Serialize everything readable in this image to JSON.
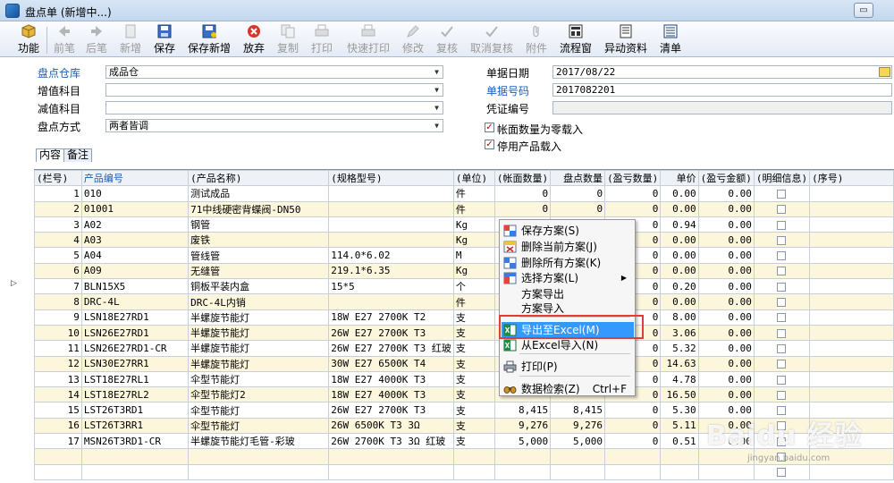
{
  "window": {
    "title": "盘点单 (新增中...)",
    "minimize_symbol": "▭"
  },
  "toolbar": [
    {
      "label": "功能",
      "icon": "function-cube-icon",
      "enabled": true
    },
    {
      "label": "前笔",
      "icon": "arrow-left-icon",
      "enabled": false
    },
    {
      "label": "后笔",
      "icon": "arrow-right-icon",
      "enabled": false
    },
    {
      "label": "新增",
      "icon": "new-document-icon",
      "enabled": false
    },
    {
      "label": "保存",
      "icon": "save-disk-icon",
      "enabled": true
    },
    {
      "label": "保存新增",
      "icon": "save-new-icon",
      "enabled": true
    },
    {
      "label": "放弃",
      "icon": "abandon-x-icon",
      "enabled": true
    },
    {
      "label": "复制",
      "icon": "copy-icon",
      "enabled": false
    },
    {
      "label": "打印",
      "icon": "print-icon",
      "enabled": false
    },
    {
      "label": "快速打印",
      "icon": "quick-print-icon",
      "enabled": false
    },
    {
      "label": "修改",
      "icon": "edit-icon",
      "enabled": false
    },
    {
      "label": "复核",
      "icon": "review-icon",
      "enabled": false
    },
    {
      "label": "取消复核",
      "icon": "cancel-review-icon",
      "enabled": false
    },
    {
      "label": "附件",
      "icon": "paperclip-icon",
      "enabled": false
    },
    {
      "label": "流程窗",
      "icon": "flow-window-icon",
      "enabled": true
    },
    {
      "label": "异动资料",
      "icon": "change-data-icon",
      "enabled": true
    },
    {
      "label": "清单",
      "icon": "list-icon",
      "enabled": true
    }
  ],
  "form": {
    "warehouse_label": "盘点仓库",
    "warehouse_value": "成品仓",
    "add_account_label": "增值科目",
    "add_account_value": "",
    "sub_account_label": "减值科目",
    "sub_account_value": "",
    "method_label": "盘点方式",
    "method_value": "两者皆调",
    "date_label": "单据日期",
    "date_value": "2017/08/22",
    "number_label": "单据号码",
    "number_value": "2017082201",
    "voucher_label": "凭证编号",
    "voucher_value": "",
    "chk_zero_label": "帐面数量为零载入",
    "chk_zero_checked": true,
    "chk_disabled_label": "停用产品载入",
    "chk_disabled_checked": true,
    "check_mark": "✓"
  },
  "tabs": [
    {
      "label": "内容"
    },
    {
      "label": "备注"
    }
  ],
  "grid": {
    "columns": [
      "(栏号)",
      "产品编号",
      "(产品名称)",
      "(规格型号)",
      "(单位)",
      "(帐面数量)",
      "盘点数量",
      "(盈亏数量)",
      "单价",
      "(盈亏金额)",
      "(明细信息)",
      "(序号)"
    ],
    "current_row_marker": "▷",
    "rows": [
      [
        "1",
        "010",
        "测试成品",
        "",
        "件",
        "0",
        "0",
        "0",
        "0.00",
        "0.00"
      ],
      [
        "2",
        "01001",
        "71中线硬密背蝶阀-DN50",
        "",
        "件",
        "0",
        "0",
        "0",
        "0.00",
        "0.00"
      ],
      [
        "3",
        "A02",
        "钢管",
        "",
        "Kg",
        "",
        "",
        "0",
        "0.94",
        "0.00"
      ],
      [
        "4",
        "A03",
        "废铁",
        "",
        "Kg",
        "",
        "",
        "0",
        "0.00",
        "0.00"
      ],
      [
        "5",
        "A04",
        "管线管",
        "114.0*6.02",
        "M",
        "",
        "",
        "0",
        "0.00",
        "0.00"
      ],
      [
        "6",
        "A09",
        "无缝管",
        "219.1*6.35",
        "Kg",
        "",
        "",
        "0",
        "0.00",
        "0.00"
      ],
      [
        "7",
        "BLN15X5",
        "铜板平装内盒",
        "15*5",
        "个",
        "",
        "",
        "0",
        "0.20",
        "0.00"
      ],
      [
        "8",
        "DRC-4L",
        "DRC-4L内销",
        "",
        "件",
        "",
        "",
        "0",
        "0.00",
        "0.00"
      ],
      [
        "9",
        "LSN18E27RD1",
        "半螺旋节能灯",
        "18W E27 2700K T2",
        "支",
        "",
        "",
        "0",
        "8.00",
        "0.00"
      ],
      [
        "10",
        "LSN26E27RD1",
        "半螺旋节能灯",
        "26W E27 2700K T3",
        "支",
        "",
        "",
        "0",
        "3.06",
        "0.00"
      ],
      [
        "11",
        "LSN26E27RD1-CR",
        "半螺旋节能灯",
        "26W E27 2700K T3 红玻",
        "支",
        "",
        "",
        "0",
        "5.32",
        "0.00"
      ],
      [
        "12",
        "LSN30E27RR1",
        "半螺旋节能灯",
        "30W E27 6500K T4",
        "支",
        "",
        "",
        "0",
        "14.63",
        "0.00"
      ],
      [
        "13",
        "LST18E27RL1",
        "伞型节能灯",
        "18W E27 4000K T3",
        "支",
        "",
        "",
        "0",
        "4.78",
        "0.00"
      ],
      [
        "14",
        "LST18E27RL2",
        "伞型节能灯2",
        "18W E27 4000K T3",
        "支",
        "",
        "",
        "0",
        "16.50",
        "0.00"
      ],
      [
        "15",
        "LST26T3RD1",
        "伞型节能灯",
        "26W E27 2700K T3",
        "支",
        "8,415",
        "8,415",
        "0",
        "5.30",
        "0.00"
      ],
      [
        "16",
        "LST26T3RR1",
        "伞型节能灯",
        "26W 6500K T3 3Ω",
        "支",
        "9,276",
        "9,276",
        "0",
        "5.11",
        "0.00"
      ],
      [
        "17",
        "MSN26T3RD1-CR",
        "半螺旋节能灯毛管-彩玻",
        "26W 2700K T3 3Ω 红玻",
        "支",
        "5,000",
        "5,000",
        "0",
        "0.51",
        "0.00"
      ]
    ]
  },
  "context_menu": {
    "items": [
      {
        "label": "保存方案(S)",
        "icon": "grid-save-icon"
      },
      {
        "label": "删除当前方案(J)",
        "icon": "grid-delete-icon"
      },
      {
        "label": "删除所有方案(K)",
        "icon": "grid-delete-all-icon"
      },
      {
        "label": "选择方案(L)",
        "icon": "grid-select-icon",
        "submenu_arrow": "▶"
      },
      {
        "label": "方案导出",
        "icon": ""
      },
      {
        "label": "方案导入",
        "icon": ""
      },
      {
        "label": "导出至Excel(M)",
        "icon": "excel-export-icon",
        "highlighted": true
      },
      {
        "label": "从Excel导入(N)",
        "icon": "excel-import-icon"
      },
      {
        "label": "打印(P)",
        "icon": "printer-icon"
      },
      {
        "label": "数据检索(Z)",
        "icon": "binoculars-icon",
        "shortcut": "Ctrl+F"
      }
    ]
  },
  "watermark": {
    "brand": "Baidu 经验",
    "url": "jingyan.baidu.com"
  }
}
